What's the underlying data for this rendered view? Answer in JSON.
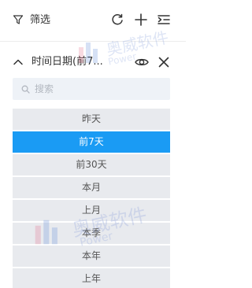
{
  "header": {
    "title": "筛选",
    "icons": {
      "filter": "filter-icon",
      "refresh": "refresh-icon",
      "add": "plus-icon",
      "collapse": "collapse-list-icon"
    }
  },
  "section": {
    "title": "时间日期(前7...",
    "expanded": true,
    "icons": {
      "chevron": "chevron-up-icon",
      "visibility": "eye-icon",
      "remove": "close-icon"
    }
  },
  "search": {
    "placeholder": "搜索",
    "value": ""
  },
  "options": [
    {
      "label": "昨天",
      "selected": false
    },
    {
      "label": "前7天",
      "selected": true
    },
    {
      "label": "前30天",
      "selected": false
    },
    {
      "label": "本月",
      "selected": false
    },
    {
      "label": "上月",
      "selected": false
    },
    {
      "label": "本季",
      "selected": false
    },
    {
      "label": "本年",
      "selected": false
    },
    {
      "label": "上年",
      "selected": false
    }
  ],
  "watermark": {
    "text": "奥威软件",
    "subtext": "Power"
  },
  "colors": {
    "accent": "#1a9bf4",
    "option_bg": "#e8eaee",
    "search_bg": "#eef2f7"
  }
}
